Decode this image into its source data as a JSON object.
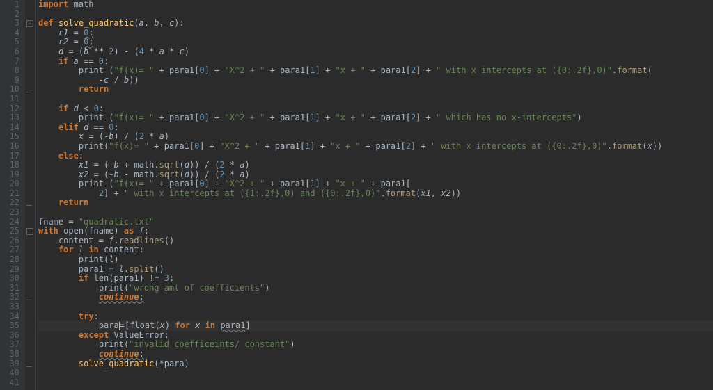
{
  "lines": {
    "1": "import math",
    "2": "",
    "3": "def solve_quadratic(a, b, c):",
    "4": "    r1 = 0;",
    "5": "    r2 = 0;",
    "6": "    d = (b ** 2) - (4 * a * c)",
    "7": "    if a == 0:",
    "8": "        print (\"f(x)= \" + para1[0] + \"X^2 + \" + para1[1] + \"x + \" + para1[2] + \" with x intercepts at ({0:.2f},0)\".format(",
    "9": "            -c / b))",
    "10": "        return",
    "11": "",
    "12": "    if d < 0:",
    "13": "        print (\"f(x)= \" + para1[0] + \"X^2 + \" + para1[1] + \"x + \" + para1[2] + \" which has no x-intercepts\")",
    "14": "    elif d == 0:",
    "15": "        x = (-b) / (2 * a)",
    "16": "        print(\"f(x)= \" + para1[0] + \"X^2 + \" + para1[1] + \"x + \" + para1[2] + \" with x intercepts at ({0:.2f},0)\".format(x))",
    "17": "    else:",
    "18": "        x1 = (-b + math.sqrt(d)) / (2 * a)",
    "19": "        x2 = (-b - math.sqrt(d)) / (2 * a)",
    "20": "        print (\"f(x)= \" + para1[0] + \"X^2 + \" + para1[1] + \"x + \" + para1[",
    "21": "            2] + \" with x intercepts at ({1:.2f},0) and ({0:.2f},0)\".format(x1, x2))",
    "22": "    return",
    "23": "",
    "24": "fname = \"quadratic.txt\"",
    "25": "with open(fname) as f:",
    "26": "    content = f.readlines()",
    "27": "    for l in content:",
    "28": "        print(l)",
    "29": "        para1 = l.split()",
    "30": "        if len(para1) != 3:",
    "31": "            print(\"wrong amt of coefficients\")",
    "32": "            continue;",
    "33": "",
    "34": "        try:",
    "35": "            para=[float(x) for x in para1]",
    "36": "        except ValueError:",
    "37": "            print(\"invalid coefficeints/ constant\")",
    "38": "            continue;",
    "39": "        solve_quadratic(*para)",
    "40": "",
    "41": ""
  },
  "current_line": 35,
  "total_lines": 41
}
